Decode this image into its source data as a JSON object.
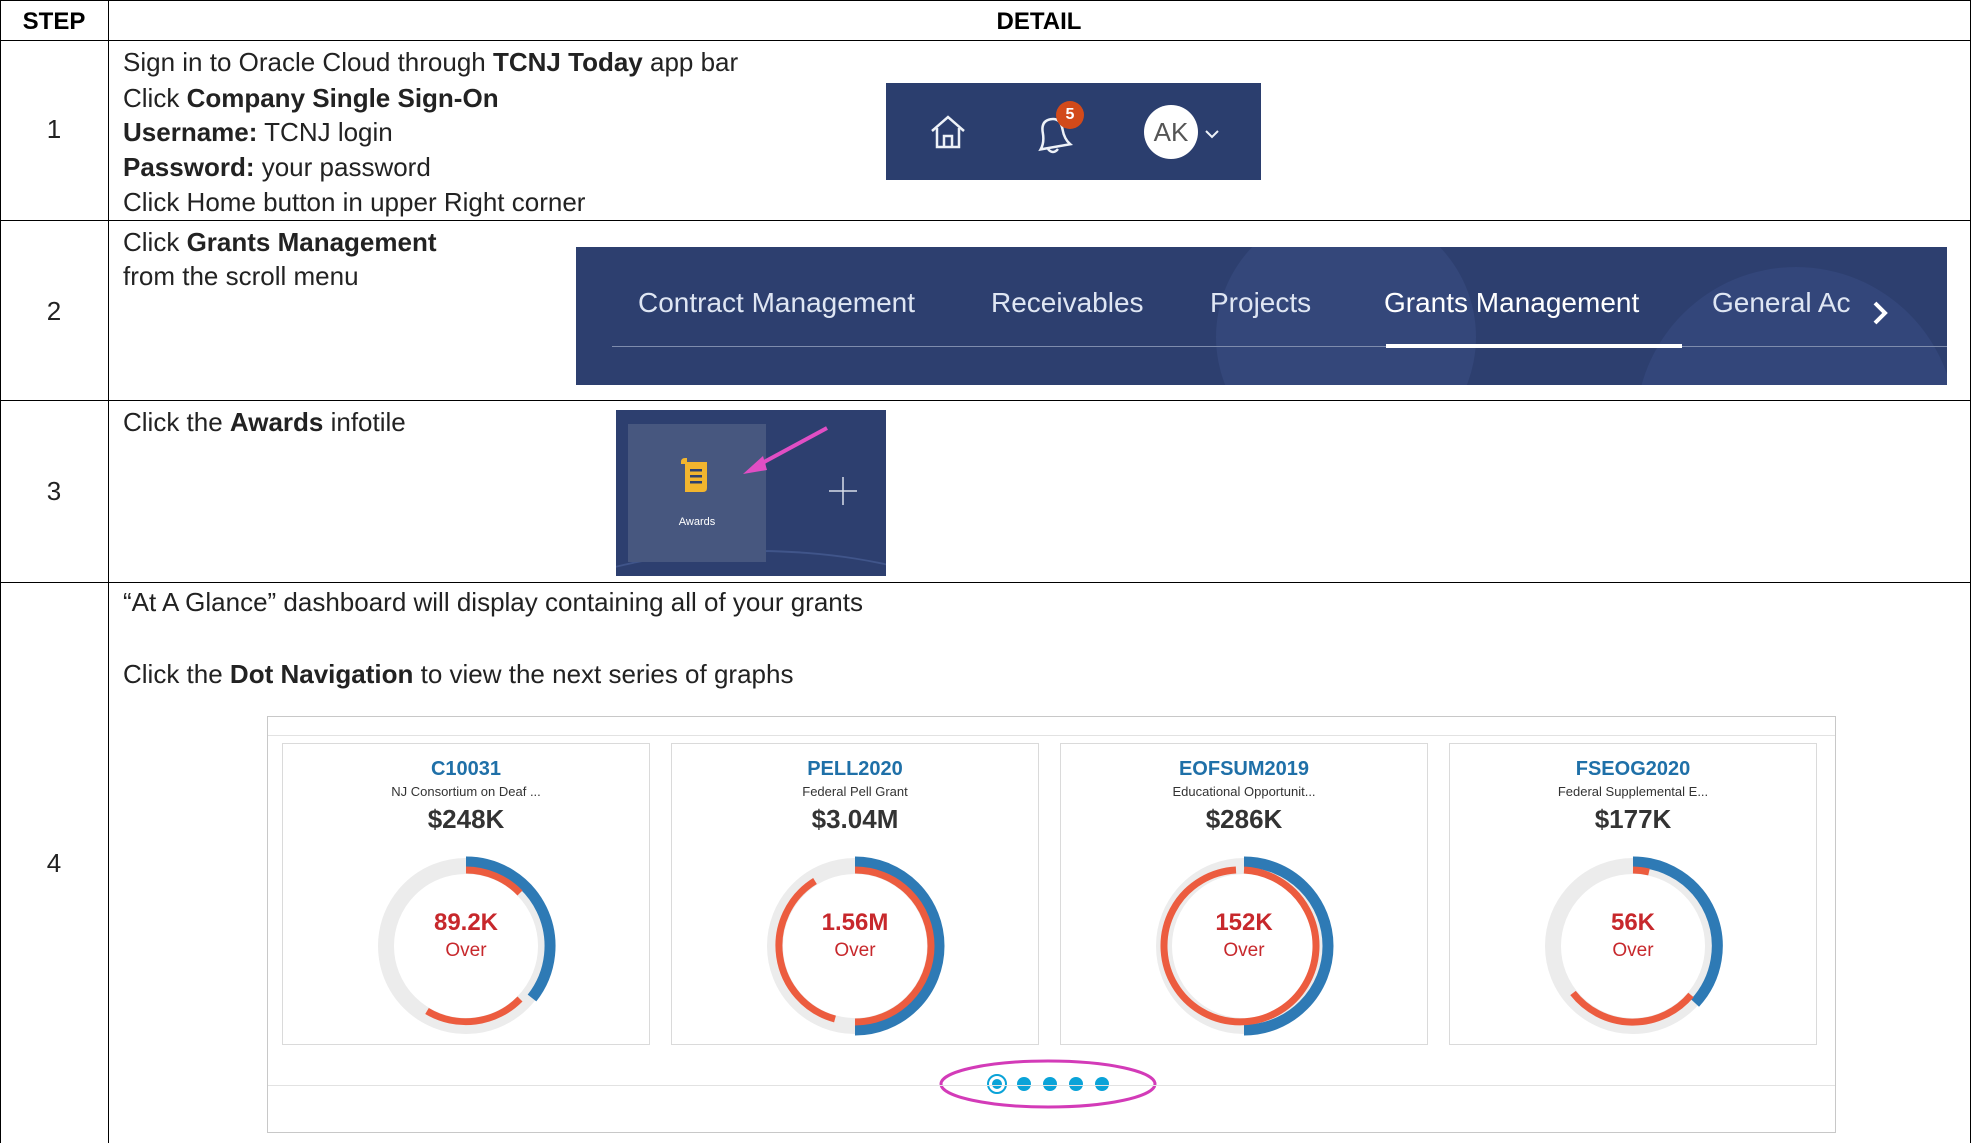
{
  "table": {
    "header": {
      "step": "STEP",
      "detail": "DETAIL"
    }
  },
  "step1": {
    "number": "1",
    "line1": {
      "pre": "Sign in to Oracle Cloud through ",
      "bold": "TCNJ Today",
      "post": " app bar"
    },
    "line2": {
      "pre": "Click ",
      "bold": "Company Single Sign-On"
    },
    "line3": {
      "bold": "Username:",
      "post": " TCNJ login"
    },
    "line4": {
      "bold": "Password:",
      "post": " your password"
    },
    "line5": "Click Home button in upper Right corner",
    "appbar": {
      "badge_count": "5",
      "avatar_initials": "AK",
      "home_icon": "home-icon",
      "bell_icon": "bell-icon",
      "color": "#2b3e6e"
    }
  },
  "step2": {
    "number": "2",
    "line1": {
      "pre": "Click ",
      "bold": "Grants Management"
    },
    "line2": "from the scroll menu",
    "nav": {
      "items": [
        "Contract Management",
        "Receivables",
        "Projects",
        "Grants Management",
        "General Ac"
      ],
      "selected": "Grants Management",
      "next_icon": "chevron-right-icon",
      "color": "#2d3f6f"
    }
  },
  "step3": {
    "number": "3",
    "line1": {
      "pre": "Click the ",
      "bold": "Awards",
      "post": " infotile"
    },
    "tile": {
      "label": "Awards",
      "icon": "document-icon",
      "add_icon": "plus-icon",
      "arrow_color": "#e04ec4"
    }
  },
  "step4": {
    "number": "4",
    "line1": "“At A Glance” dashboard will display containing all of your grants",
    "line2": {
      "pre": "Click the ",
      "bold": "Dot Navigation",
      "post": " to view the next series of graphs"
    },
    "cards": [
      {
        "id": "C10031",
        "name": "NJ Consortium on Deaf ...",
        "amount": "$248K",
        "value": "89.2K",
        "status": "Over"
      },
      {
        "id": "PELL2020",
        "name": "Federal Pell Grant",
        "amount": "$3.04M",
        "value": "1.56M",
        "status": "Over"
      },
      {
        "id": "EOFSUM2019",
        "name": "Educational Opportunit...",
        "amount": "$286K",
        "value": "152K",
        "status": "Over"
      },
      {
        "id": "FSEOG2020",
        "name": "Federal Supplemental E...",
        "amount": "$177K",
        "value": "56K",
        "status": "Over"
      }
    ],
    "dots": {
      "count": 5,
      "active": 0,
      "color": "#0aa3d8",
      "highlight": "#d33bb8"
    },
    "colors": {
      "blue_ring": "#2e7ab5",
      "red_ring": "#ec5c3f",
      "track": "#ececec",
      "value_text": "#c7282c"
    }
  }
}
